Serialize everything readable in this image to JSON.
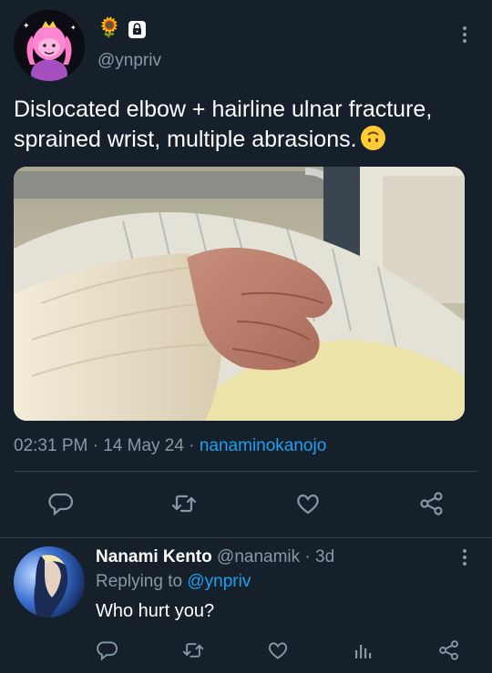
{
  "tweet": {
    "emojis": [
      "🌻"
    ],
    "handle": "@ynpriv",
    "text": "Dislocated elbow + hairline ulnar fracture, sprained wrist, multiple abrasions.",
    "time": "02:31 PM",
    "date": "14 May 24",
    "source": "nanaminokanojo",
    "separator": "·"
  },
  "actions": {
    "icons": [
      "reply-icon",
      "retweet-icon",
      "like-icon",
      "share-icon"
    ]
  },
  "reply": {
    "name": "Nanami Kento",
    "handle": "@nanamik",
    "age": "3d",
    "replying_prefix": "Replying to",
    "replying_to": "@ynpriv",
    "text": "Who hurt you?",
    "icons": [
      "reply-icon",
      "retweet-icon",
      "like-icon",
      "analytics-icon",
      "share-icon"
    ]
  },
  "colors": {
    "background": "#15202b",
    "secondary_text": "#8899a6",
    "accent": "#1da1f2",
    "divider": "#38444d"
  }
}
